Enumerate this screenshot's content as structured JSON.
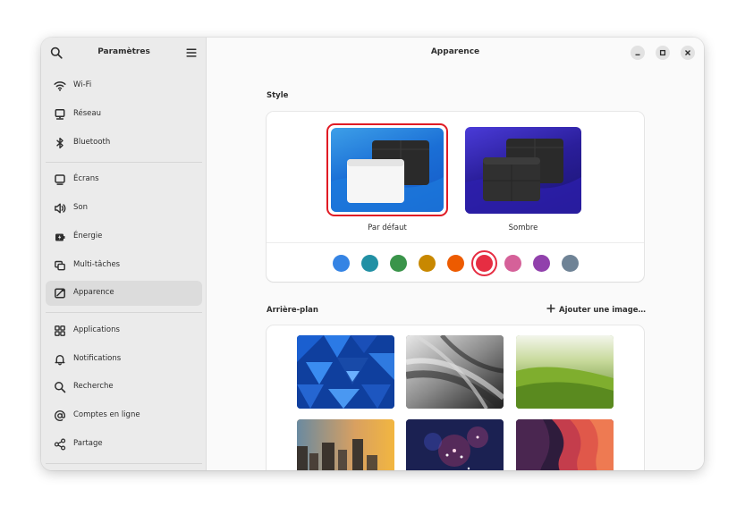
{
  "sidebar": {
    "title": "Paramètres",
    "items": [
      {
        "label": "Wi-Fi",
        "icon": "wifi-icon"
      },
      {
        "label": "Réseau",
        "icon": "network-icon"
      },
      {
        "label": "Bluetooth",
        "icon": "bluetooth-icon"
      },
      {
        "label": "Écrans",
        "icon": "display-icon"
      },
      {
        "label": "Son",
        "icon": "sound-icon"
      },
      {
        "label": "Énergie",
        "icon": "power-icon"
      },
      {
        "label": "Multi-tâches",
        "icon": "multitasking-icon"
      },
      {
        "label": "Apparence",
        "icon": "appearance-icon",
        "active": true
      },
      {
        "label": "Applications",
        "icon": "apps-icon"
      },
      {
        "label": "Notifications",
        "icon": "bell-icon"
      },
      {
        "label": "Recherche",
        "icon": "search-icon"
      },
      {
        "label": "Comptes en ligne",
        "icon": "at-icon"
      },
      {
        "label": "Partage",
        "icon": "share-icon"
      }
    ]
  },
  "header": {
    "title": "Apparence"
  },
  "style": {
    "label": "Style",
    "options": [
      {
        "label": "Par défaut",
        "selected": true
      },
      {
        "label": "Sombre",
        "selected": false
      }
    ],
    "selected_color": "#e01b24",
    "accents": [
      {
        "name": "blue",
        "color": "#3584e4"
      },
      {
        "name": "teal",
        "color": "#2190a4"
      },
      {
        "name": "green",
        "color": "#3a944a"
      },
      {
        "name": "yellow",
        "color": "#c88800"
      },
      {
        "name": "orange",
        "color": "#ed5b00"
      },
      {
        "name": "red",
        "color": "#e62d42",
        "selected": true
      },
      {
        "name": "pink",
        "color": "#d56199"
      },
      {
        "name": "purple",
        "color": "#9141ac"
      },
      {
        "name": "slate",
        "color": "#6f8396"
      }
    ]
  },
  "background": {
    "label": "Arrière-plan",
    "add_label": "Ajouter une image…",
    "wallpapers": [
      "blue-triangles",
      "grey-spiral",
      "green-hills",
      "city-sunset",
      "fireworks",
      "purple-waves"
    ]
  }
}
